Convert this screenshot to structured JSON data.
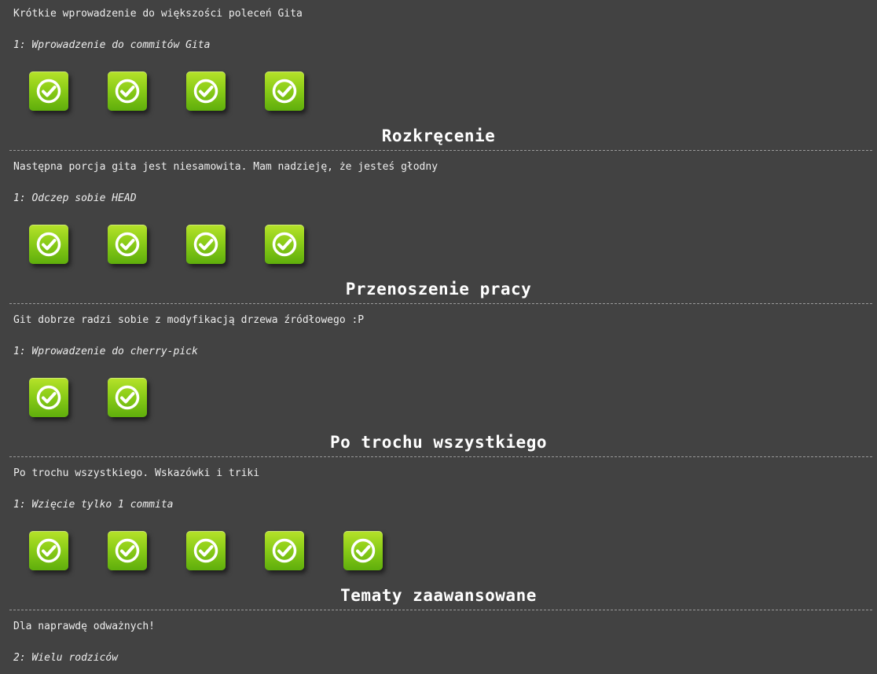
{
  "sections": [
    {
      "title": "",
      "description": "Krótkie wprowadzenie do większości poleceń Gita",
      "level_label": "1: Wprowadzenie do commitów Gita",
      "levels_completed": 4
    },
    {
      "title": "Rozkręcenie",
      "description": "Następna porcja gita jest niesamowita. Mam nadzieję, że jesteś głodny",
      "level_label": "1: Odczep sobie HEAD",
      "levels_completed": 4
    },
    {
      "title": "Przenoszenie pracy",
      "description": "Git dobrze radzi sobie z modyfikacją drzewa źródłowego :P",
      "level_label": "1: Wprowadzenie do cherry-pick",
      "levels_completed": 2
    },
    {
      "title": "Po trochu wszystkiego",
      "description": "Po trochu wszystkiego. Wskazówki i triki",
      "level_label": "1: Wzięcie tylko 1 commita",
      "levels_completed": 5
    },
    {
      "title": "Tematy zaawansowane",
      "description": "Dla naprawdę odważnych!",
      "level_label": "2: Wielu rodziców"
    }
  ],
  "icon": "checkmark-icon",
  "colors": {
    "background": "#424242",
    "icon_green_top": "#b6e22a",
    "icon_green_bottom": "#5fae0c",
    "text": "#eeeeee",
    "title": "#ffffff"
  }
}
